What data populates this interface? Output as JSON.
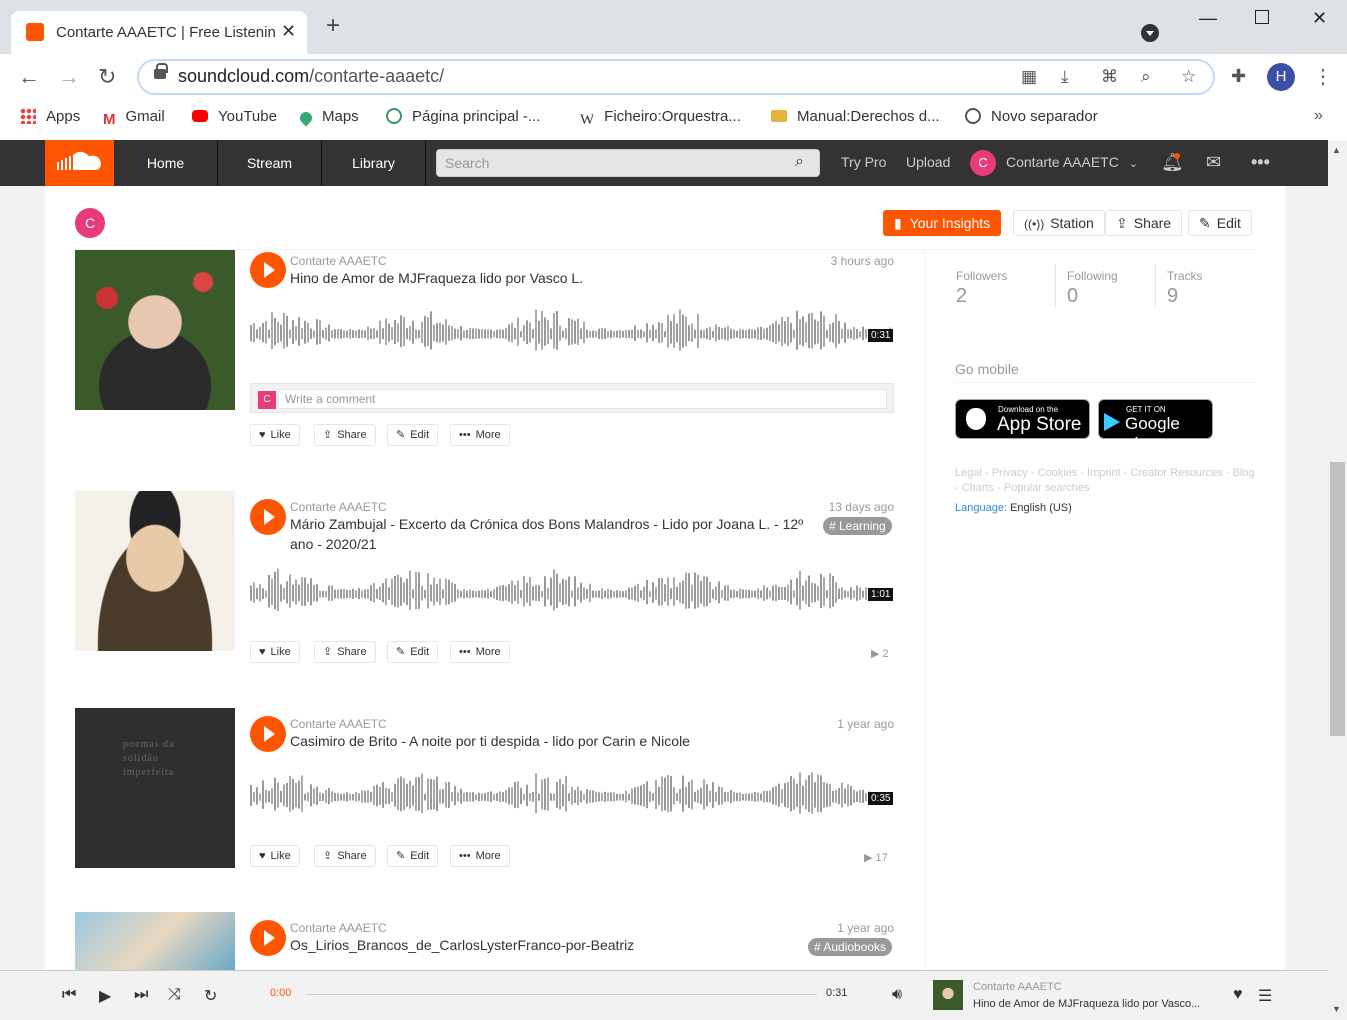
{
  "browser": {
    "tab_title": "Contarte AAAETC | Free Listening",
    "tab_close": "✕",
    "new_tab": "+",
    "url_host": "soundcloud.com",
    "url_path": "/contarte-aaaetc/",
    "profile_initial": "H",
    "bookmarks": [
      "Apps",
      "Gmail",
      "YouTube",
      "Maps",
      "Página principal -...",
      "Ficheiro:Orquestra...",
      "Manual:Derechos d...",
      "Novo separador"
    ],
    "bookmarks_more": "»"
  },
  "sc_header": {
    "nav": [
      "Home",
      "Stream",
      "Library"
    ],
    "search_placeholder": "Search",
    "try_pro": "Try Pro",
    "upload": "Upload",
    "avatar_initial": "C",
    "username": "Contarte AAAETC",
    "accent": "#ff5500"
  },
  "profile_bar": {
    "avatar_initial": "C",
    "insights": "Your Insights",
    "station": "Station",
    "share": "Share",
    "edit": "Edit"
  },
  "tracks": [
    {
      "user": "Contarte AAAETC",
      "title": "Hino de Amor de MJFraqueza lido por Vasco L.",
      "date": "3 hours ago",
      "duration": "0:31",
      "comment_placeholder": "Write a comment",
      "comment_avatar": "C"
    },
    {
      "user": "Contarte AAAETC",
      "title": "Mário Zambujal - Excerto da Crónica dos Bons Malandros - Lido por Joana L. - 12º ano - 2020/21",
      "date": "13 days ago",
      "tag": "# Learning",
      "duration": "1:01",
      "plays": "2"
    },
    {
      "user": "Contarte AAAETC",
      "title": "Casimiro de Brito - A noite por ti despida - lido por Carin e Nicole",
      "date": "1 year ago",
      "duration": "0:35",
      "plays": "17",
      "art_text": "poemas da solidão imperfeita"
    },
    {
      "user": "Contarte AAAETC",
      "title": "Os_Lirios_Brancos_de_CarlosLysterFranco-por-Beatriz",
      "date": "1 year ago",
      "tag": "# Audiobooks"
    }
  ],
  "actions": {
    "like": "Like",
    "share": "Share",
    "edit": "Edit",
    "more": "More"
  },
  "sidebar": {
    "followers_label": "Followers",
    "followers": "2",
    "following_label": "Following",
    "following": "0",
    "tracks_label": "Tracks",
    "tracks": "9",
    "go_mobile": "Go mobile",
    "appstore_small": "Download on the",
    "appstore_big": "App Store",
    "gplay_small": "GET IT ON",
    "gplay_big": "Google play",
    "footer_links": "Legal - Privacy - Cookies - Imprint - Creator Resources - Blog - Charts - Popular searches",
    "language_label": "Language:",
    "language": "English (US)"
  },
  "player": {
    "current_time": "0:00",
    "duration": "0:31",
    "user": "Contarte AAAETC",
    "title": "Hino de Amor de MJFraqueza lido por Vasco..."
  }
}
